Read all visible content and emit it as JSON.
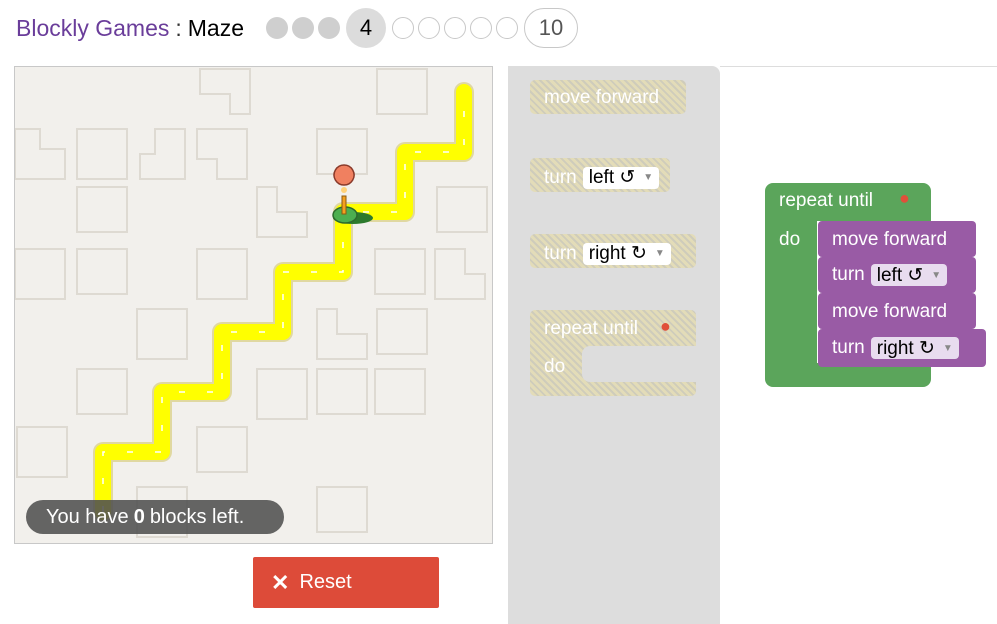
{
  "header": {
    "app_title": "Blockly Games",
    "separator": ":",
    "level_name": "Maze",
    "levels": [
      {
        "label": "",
        "state": "done"
      },
      {
        "label": "",
        "state": "done"
      },
      {
        "label": "",
        "state": "done"
      },
      {
        "label": "4",
        "state": "current"
      },
      {
        "label": "",
        "state": "todo"
      },
      {
        "label": "",
        "state": "todo"
      },
      {
        "label": "",
        "state": "todo"
      },
      {
        "label": "",
        "state": "todo"
      },
      {
        "label": "",
        "state": "todo"
      },
      {
        "label": "10",
        "state": "todo"
      }
    ]
  },
  "maze": {
    "capacity_prefix": "You have",
    "capacity_count": "0",
    "capacity_suffix": "blocks left.",
    "path_color": "#ffff00",
    "marker_icon": "map-marker-icon",
    "player_icon": "pegman-icon"
  },
  "controls": {
    "reset_label": "Reset",
    "reset_color": "#dd4b39"
  },
  "toolbox": {
    "move_forward": "move forward",
    "turn_left_prefix": "turn",
    "turn_left_option": "left ↺",
    "turn_right_prefix": "turn",
    "turn_right_option": "right ↻",
    "repeat_label": "repeat until",
    "do_label": "do"
  },
  "program": {
    "repeat_label": "repeat until",
    "do_label": "do",
    "statements": [
      {
        "text": "move forward"
      },
      {
        "text": "turn",
        "option": "left ↺"
      },
      {
        "text": "move forward"
      },
      {
        "text": "turn",
        "option": "right ↻"
      }
    ],
    "loop_color": "#5ba55b",
    "movement_color": "#995ba5"
  }
}
